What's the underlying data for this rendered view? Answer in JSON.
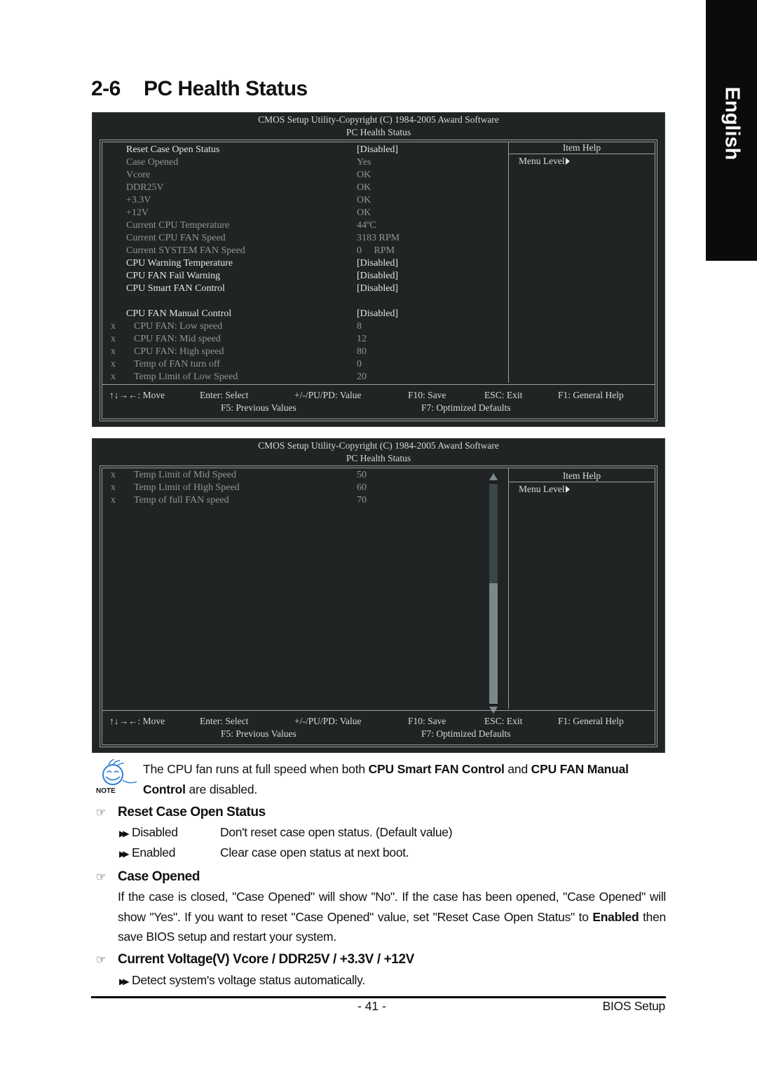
{
  "side_tab": {
    "label": "English"
  },
  "section": {
    "number": "2-6",
    "title": "PC Health Status"
  },
  "bios_common": {
    "copyright": "CMOS Setup Utility-Copyright (C) 1984-2005 Award Software",
    "screen_title": "PC Health Status",
    "help_title": "Item Help",
    "help_menu_level": "Menu Level",
    "keys": {
      "move": "↑↓→←: Move",
      "enter": "Enter: Select",
      "value": "+/-/PU/PD: Value",
      "save": "F10: Save",
      "exit": "ESC: Exit",
      "help": "F1: General Help",
      "previous": "F5: Previous Values",
      "defaults": "F7: Optimized Defaults"
    }
  },
  "screen1": {
    "rows": [
      {
        "marker": "",
        "label": "Reset Case Open Status",
        "value": "[Disabled]",
        "state": "active"
      },
      {
        "marker": "",
        "label": "Case Opened",
        "value": "Yes",
        "state": "dim"
      },
      {
        "marker": "",
        "label": "Vcore",
        "value": "OK",
        "state": "dim"
      },
      {
        "marker": "",
        "label": "DDR25V",
        "value": "OK",
        "state": "dim"
      },
      {
        "marker": "",
        "label": "+3.3V",
        "value": "OK",
        "state": "dim"
      },
      {
        "marker": "",
        "label": "+12V",
        "value": "OK",
        "state": "dim"
      },
      {
        "marker": "",
        "label": "Current CPU Temperature",
        "value": "44ºC",
        "state": "dim"
      },
      {
        "marker": "",
        "label": "Current CPU FAN Speed",
        "value": "3183 RPM",
        "state": "dim"
      },
      {
        "marker": "",
        "label": "Current SYSTEM FAN Speed",
        "value": "0     RPM",
        "state": "dim"
      },
      {
        "marker": "",
        "label": "CPU Warning Temperature",
        "value": "[Disabled]",
        "state": "active"
      },
      {
        "marker": "",
        "label": "CPU FAN Fail Warning",
        "value": "[Disabled]",
        "state": "active"
      },
      {
        "marker": "",
        "label": "CPU Smart FAN Control",
        "value": "[Disabled]",
        "state": "active"
      },
      {
        "marker": "",
        "label": "",
        "value": "",
        "state": "blank"
      },
      {
        "marker": "",
        "label": "CPU FAN Manual Control",
        "value": "[Disabled]",
        "state": "active"
      },
      {
        "marker": "x",
        "label": "CPU FAN: Low speed",
        "value": "8",
        "state": "dim"
      },
      {
        "marker": "x",
        "label": "CPU FAN: Mid speed",
        "value": "12",
        "state": "dim"
      },
      {
        "marker": "x",
        "label": "CPU FAN: High speed",
        "value": "80",
        "state": "dim"
      },
      {
        "marker": "x",
        "label": "Temp of FAN turn off",
        "value": "0",
        "state": "dim"
      },
      {
        "marker": "x",
        "label": "Temp Limit of Low Speed",
        "value": "20",
        "state": "dim"
      }
    ]
  },
  "screen2": {
    "rows": [
      {
        "marker": "x",
        "label": "Temp Limit of Mid Speed",
        "value": "50",
        "state": "dim"
      },
      {
        "marker": "x",
        "label": "Temp Limit of High Speed",
        "value": "60",
        "state": "dim"
      },
      {
        "marker": "x",
        "label": "Temp of full FAN speed",
        "value": "70",
        "state": "dim"
      }
    ],
    "scroll_position_fraction": 0.55
  },
  "note": {
    "label": "NOTE",
    "text_1": "The CPU fan runs at full speed when both ",
    "bold_1": "CPU Smart FAN Control",
    "text_2": " and ",
    "bold_2": "CPU FAN Manual Control",
    "text_3": " are disabled."
  },
  "items": {
    "reset_case": {
      "title": "Reset Case Open Status",
      "options": [
        {
          "name": "Disabled",
          "desc": "Don't reset case open status. (Default value)"
        },
        {
          "name": "Enabled",
          "desc": "Clear case open status at next boot."
        }
      ]
    },
    "case_opened": {
      "title": "Case Opened",
      "text_1": "If the case is closed, \"Case Opened\" will show \"No\". If the case has been opened, \"Case Opened\" will show \"Yes\". If you want to reset \"Case Opened\" value, set \"Reset Case Open Status\" to ",
      "bold": "Enabled",
      "text_2": " then save BIOS setup and restart your system."
    },
    "voltage": {
      "title": "Current Voltage(V) Vcore / DDR25V / +3.3V / +12V",
      "desc": "Detect system's voltage status automatically."
    }
  },
  "footer": {
    "page": "- 41 -",
    "section": "BIOS Setup"
  }
}
